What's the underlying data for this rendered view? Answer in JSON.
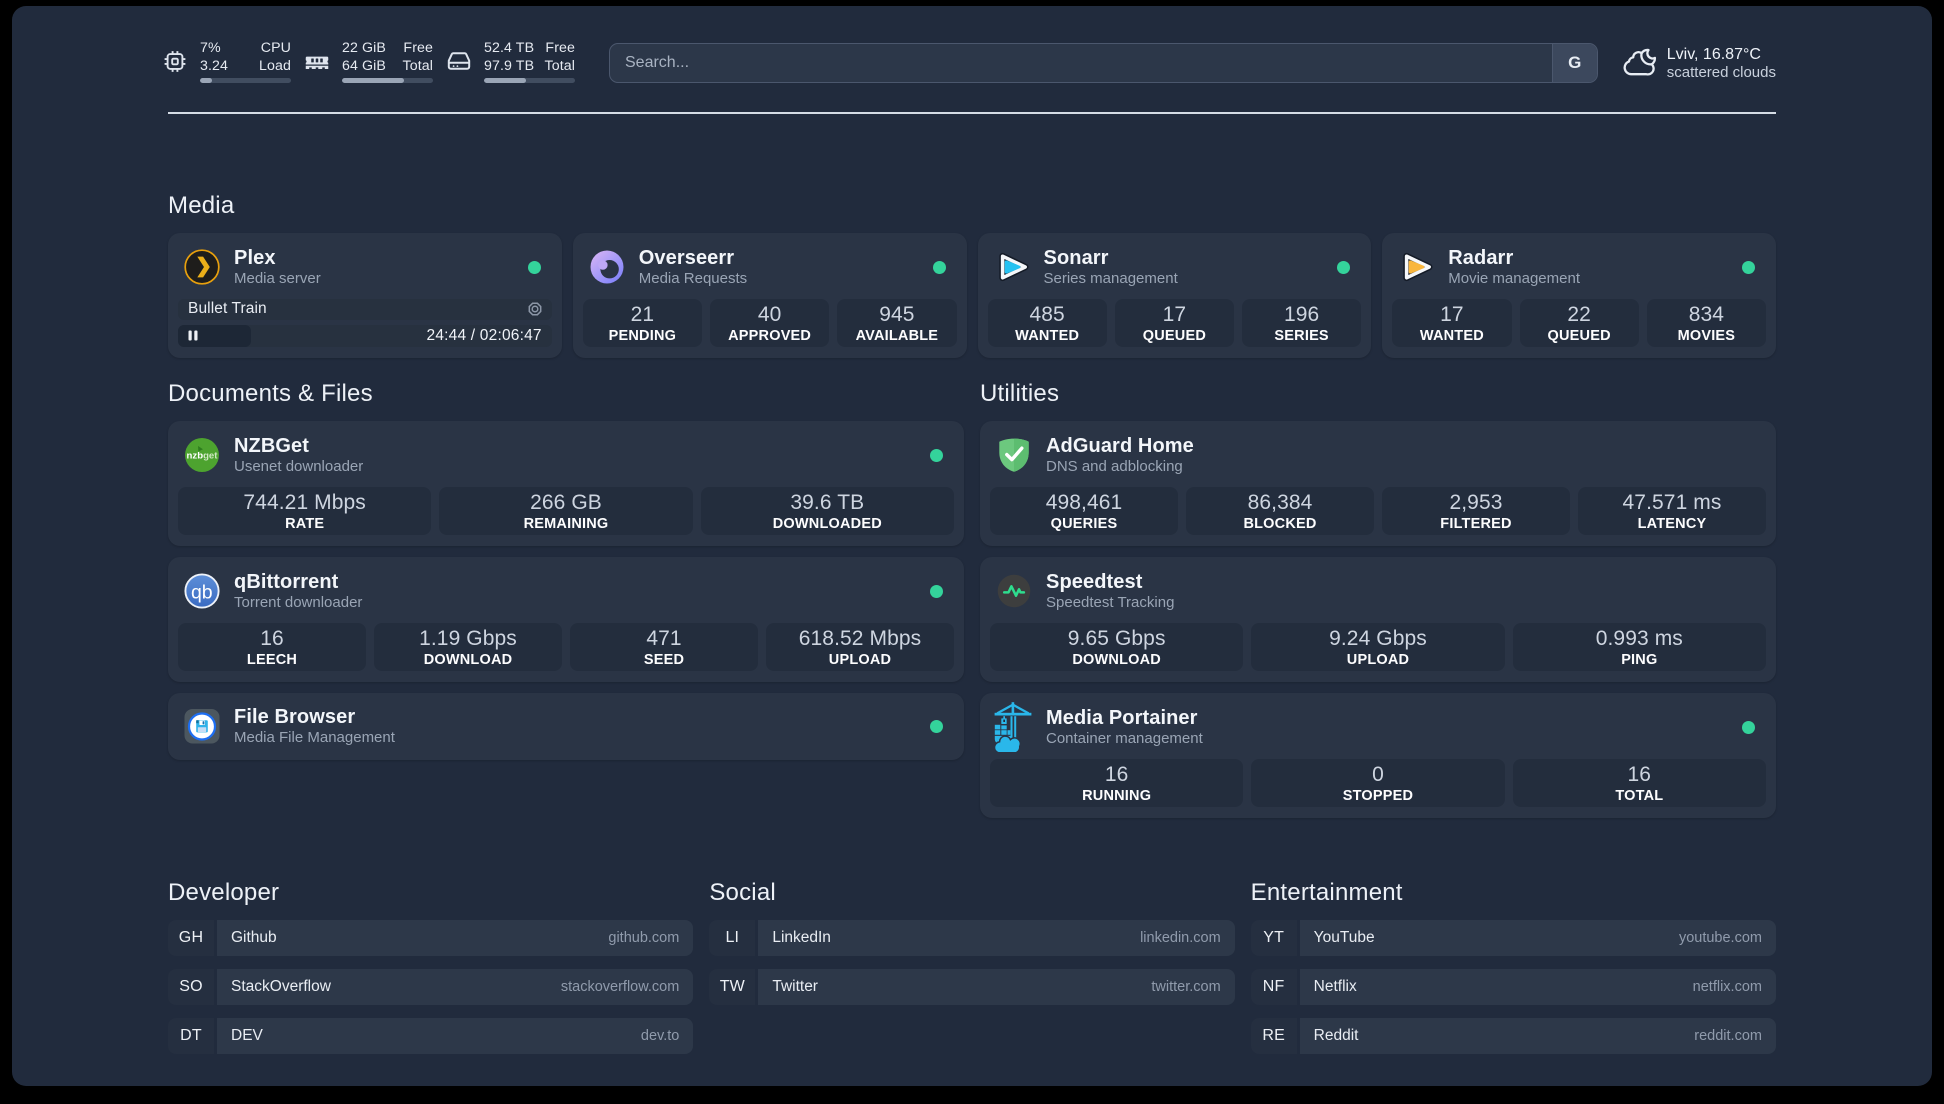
{
  "topbar": {
    "resources": [
      {
        "icon": "cpu-icon",
        "v1": "7%",
        "v2": "3.24",
        "l1": "CPU",
        "l2": "Load",
        "fill": 13
      },
      {
        "icon": "memory-icon",
        "v1": "22 GiB",
        "v2": "64 GiB",
        "l1": "Free",
        "l2": "Total",
        "fill": 68
      },
      {
        "icon": "disk-icon",
        "v1": "52.4 TB",
        "v2": "97.9 TB",
        "l1": "Free",
        "l2": "Total",
        "fill": 46
      }
    ],
    "search": {
      "placeholder": "Search...",
      "button_label": "G"
    },
    "weather": {
      "line1": "Lviv, 16.87°C",
      "line2": "scattered clouds"
    }
  },
  "sections": {
    "media": {
      "title": "Media",
      "cards": {
        "plex": {
          "title": "Plex",
          "subtitle": "Media server",
          "online": true,
          "now_playing": "Bullet Train",
          "time": "24:44 / 02:06:47",
          "progress_percent": 19.5
        },
        "overseerr": {
          "title": "Overseerr",
          "subtitle": "Media Requests",
          "online": true,
          "stats": [
            {
              "value": "21",
              "label": "PENDING"
            },
            {
              "value": "40",
              "label": "APPROVED"
            },
            {
              "value": "945",
              "label": "AVAILABLE"
            }
          ]
        },
        "sonarr": {
          "title": "Sonarr",
          "subtitle": "Series management",
          "online": true,
          "stats": [
            {
              "value": "485",
              "label": "WANTED"
            },
            {
              "value": "17",
              "label": "QUEUED"
            },
            {
              "value": "196",
              "label": "SERIES"
            }
          ]
        },
        "radarr": {
          "title": "Radarr",
          "subtitle": "Movie management",
          "online": true,
          "stats": [
            {
              "value": "17",
              "label": "WANTED"
            },
            {
              "value": "22",
              "label": "QUEUED"
            },
            {
              "value": "834",
              "label": "MOVIES"
            }
          ]
        }
      }
    },
    "documents": {
      "title": "Documents & Files",
      "cards": {
        "nzbget": {
          "title": "NZBGet",
          "subtitle": "Usenet downloader",
          "online": true,
          "stats": [
            {
              "value": "744.21 Mbps",
              "label": "RATE"
            },
            {
              "value": "266 GB",
              "label": "REMAINING"
            },
            {
              "value": "39.6 TB",
              "label": "DOWNLOADED"
            }
          ]
        },
        "qbittorrent": {
          "title": "qBittorrent",
          "subtitle": "Torrent downloader",
          "online": true,
          "stats": [
            {
              "value": "16",
              "label": "LEECH"
            },
            {
              "value": "1.19 Gbps",
              "label": "DOWNLOAD"
            },
            {
              "value": "471",
              "label": "SEED"
            },
            {
              "value": "618.52 Mbps",
              "label": "UPLOAD"
            }
          ]
        },
        "filebrowser": {
          "title": "File Browser",
          "subtitle": "Media File Management",
          "online": true
        }
      }
    },
    "utilities": {
      "title": "Utilities",
      "cards": {
        "adguard": {
          "title": "AdGuard Home",
          "subtitle": "DNS and adblocking",
          "online": false,
          "stats": [
            {
              "value": "498,461",
              "label": "QUERIES"
            },
            {
              "value": "86,384",
              "label": "BLOCKED"
            },
            {
              "value": "2,953",
              "label": "FILTERED"
            },
            {
              "value": "47.571 ms",
              "label": "LATENCY"
            }
          ]
        },
        "speedtest": {
          "title": "Speedtest",
          "subtitle": "Speedtest Tracking",
          "online": false,
          "stats": [
            {
              "value": "9.65 Gbps",
              "label": "DOWNLOAD"
            },
            {
              "value": "9.24 Gbps",
              "label": "UPLOAD"
            },
            {
              "value": "0.993 ms",
              "label": "PING"
            }
          ]
        },
        "portainer": {
          "title": "Media Portainer",
          "subtitle": "Container management",
          "online": true,
          "stats": [
            {
              "value": "16",
              "label": "RUNNING"
            },
            {
              "value": "0",
              "label": "STOPPED"
            },
            {
              "value": "16",
              "label": "TOTAL"
            }
          ]
        }
      }
    }
  },
  "bookmarks": {
    "groups": [
      {
        "title": "Developer",
        "items": [
          {
            "abbr": "GH",
            "name": "Github",
            "url": "github.com"
          },
          {
            "abbr": "SO",
            "name": "StackOverflow",
            "url": "stackoverflow.com"
          },
          {
            "abbr": "DT",
            "name": "DEV",
            "url": "dev.to"
          }
        ]
      },
      {
        "title": "Social",
        "items": [
          {
            "abbr": "LI",
            "name": "LinkedIn",
            "url": "linkedin.com"
          },
          {
            "abbr": "TW",
            "name": "Twitter",
            "url": "twitter.com"
          }
        ]
      },
      {
        "title": "Entertainment",
        "items": [
          {
            "abbr": "YT",
            "name": "YouTube",
            "url": "youtube.com"
          },
          {
            "abbr": "NF",
            "name": "Netflix",
            "url": "netflix.com"
          },
          {
            "abbr": "RE",
            "name": "Reddit",
            "url": "reddit.com"
          }
        ]
      }
    ]
  },
  "colors": {
    "status_online": "#34d39b",
    "page_background": "#212b3d",
    "card_background": "#2b3547"
  }
}
